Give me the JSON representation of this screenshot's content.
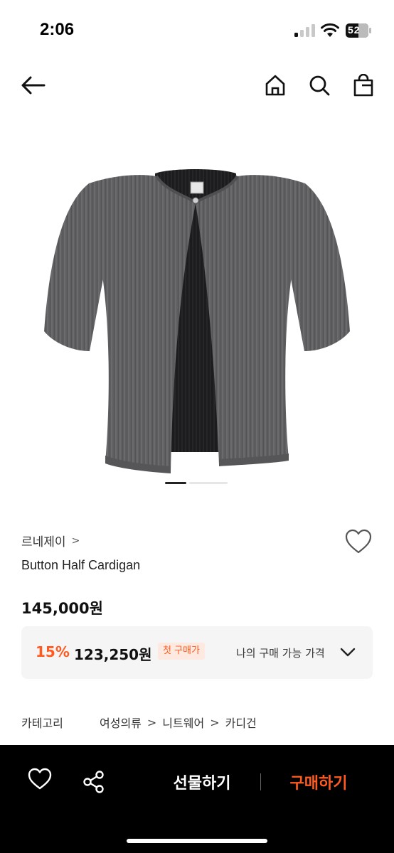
{
  "status": {
    "time": "2:06",
    "battery": "52"
  },
  "product": {
    "brand": "르네제이",
    "brand_chevron": ">",
    "name": "Button Half Cardigan",
    "price": "145,000원",
    "image_alt": "gray ribbed short-sleeve button cardigan",
    "carousel_total": 2,
    "carousel_active": 1
  },
  "coupon": {
    "discount_rate": "15%",
    "discount_price": "123,250원",
    "badge": "첫 구매가",
    "my_price_label": "나의 구매 가능 가격"
  },
  "category": {
    "label": "카테고리",
    "crumbs": [
      "여성의류",
      "니트웨어",
      "카디건"
    ],
    "separator": ">"
  },
  "bottom_bar": {
    "gift_label": "선물하기",
    "buy_label": "구매하기"
  },
  "colors": {
    "accent": "#ff5a1f",
    "bottom_bar": "#000000",
    "coupon_bg": "#f5f5f5"
  },
  "icons": [
    "back-arrow-icon",
    "home-icon",
    "search-icon",
    "shopping-bag-icon",
    "heart-icon",
    "share-icon",
    "chevron-down-icon"
  ]
}
